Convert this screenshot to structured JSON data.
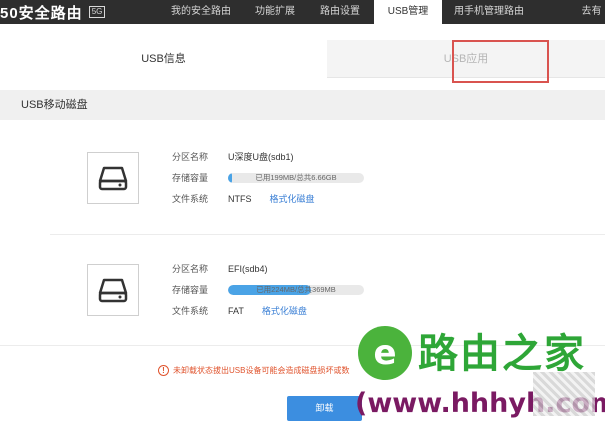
{
  "brand": {
    "name": "50安全路由",
    "badge": "5G"
  },
  "nav": {
    "tabs": [
      {
        "label": "我的安全路由"
      },
      {
        "label": "功能扩展"
      },
      {
        "label": "路由设置"
      },
      {
        "label": "USB管理",
        "active": true
      },
      {
        "label": "用手机管理路由"
      },
      {
        "label": "去有"
      }
    ]
  },
  "subtabs": [
    {
      "label": "USB信息",
      "active": true
    },
    {
      "label": "USB应用",
      "active": false
    }
  ],
  "section": {
    "title": "USB移动磁盘"
  },
  "labels": {
    "partition": "分区名称",
    "storage": "存储容量",
    "filesystem": "文件系统",
    "format": "格式化磁盘"
  },
  "disks": [
    {
      "partition": "U深度U盘(sdb1)",
      "storage_text": "已用199MB/总共6.66GB",
      "used_fraction": 0.03,
      "filesystem": "NTFS"
    },
    {
      "partition": "EFI(sdb4)",
      "storage_text": "已用224MB/总共369MB",
      "used_fraction": 0.61,
      "filesystem": "FAT"
    }
  ],
  "warning": "未卸载状态拔出USB设备可能会造成磁盘损坏或数",
  "unmount_button": "卸载",
  "watermark": {
    "logo": "e",
    "text": "路由之家",
    "url": "(www.hhhyh.com)"
  },
  "colors": {
    "accent": "#3c8ee0",
    "warning": "#e0542e",
    "topbar": "#2e2e2e",
    "highlight": "#d9534f"
  },
  "icons": {
    "disk": "hard-drive-icon",
    "warning": "warning-icon"
  }
}
